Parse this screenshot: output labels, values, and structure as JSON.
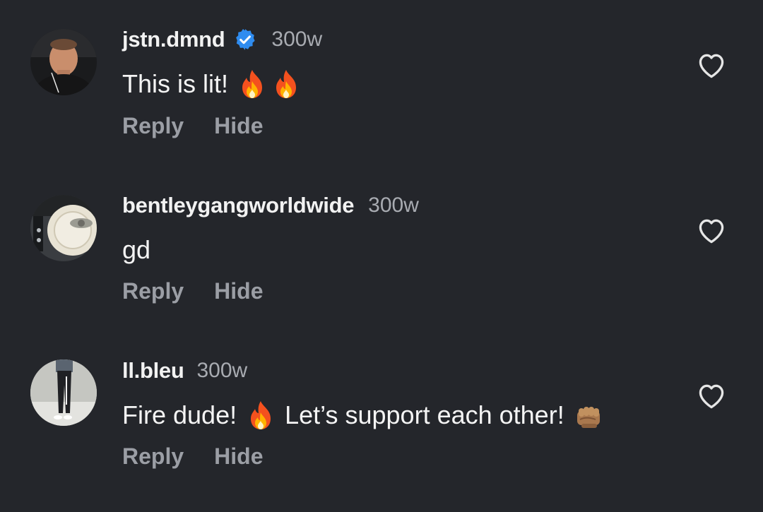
{
  "comments": [
    {
      "username": "jstn.dmnd",
      "verified": true,
      "time": "300w",
      "text": "This is lit!",
      "emojis": [
        "fire-emoji",
        "fire-emoji"
      ],
      "reply_label": "Reply",
      "hide_label": "Hide"
    },
    {
      "username": "bentleygangworldwide",
      "verified": false,
      "time": "300w",
      "text": "gd",
      "emojis": [],
      "reply_label": "Reply",
      "hide_label": "Hide"
    },
    {
      "username": "ll.bleu",
      "verified": false,
      "time": "300w",
      "text_part1": "Fire dude!",
      "text_part2": "Let’s support each other!",
      "emojis": [
        "fire-emoji",
        "fist-bump-emoji"
      ],
      "reply_label": "Reply",
      "hide_label": "Hide"
    }
  ],
  "icons": {
    "like": "heart-outline-icon",
    "verified": "verified-badge-icon"
  },
  "colors": {
    "background": "#24262b",
    "username": "#f2f2f2",
    "timestamp": "#a8abb1",
    "action": "#9b9ea5",
    "verified": "#2f8cf0"
  }
}
